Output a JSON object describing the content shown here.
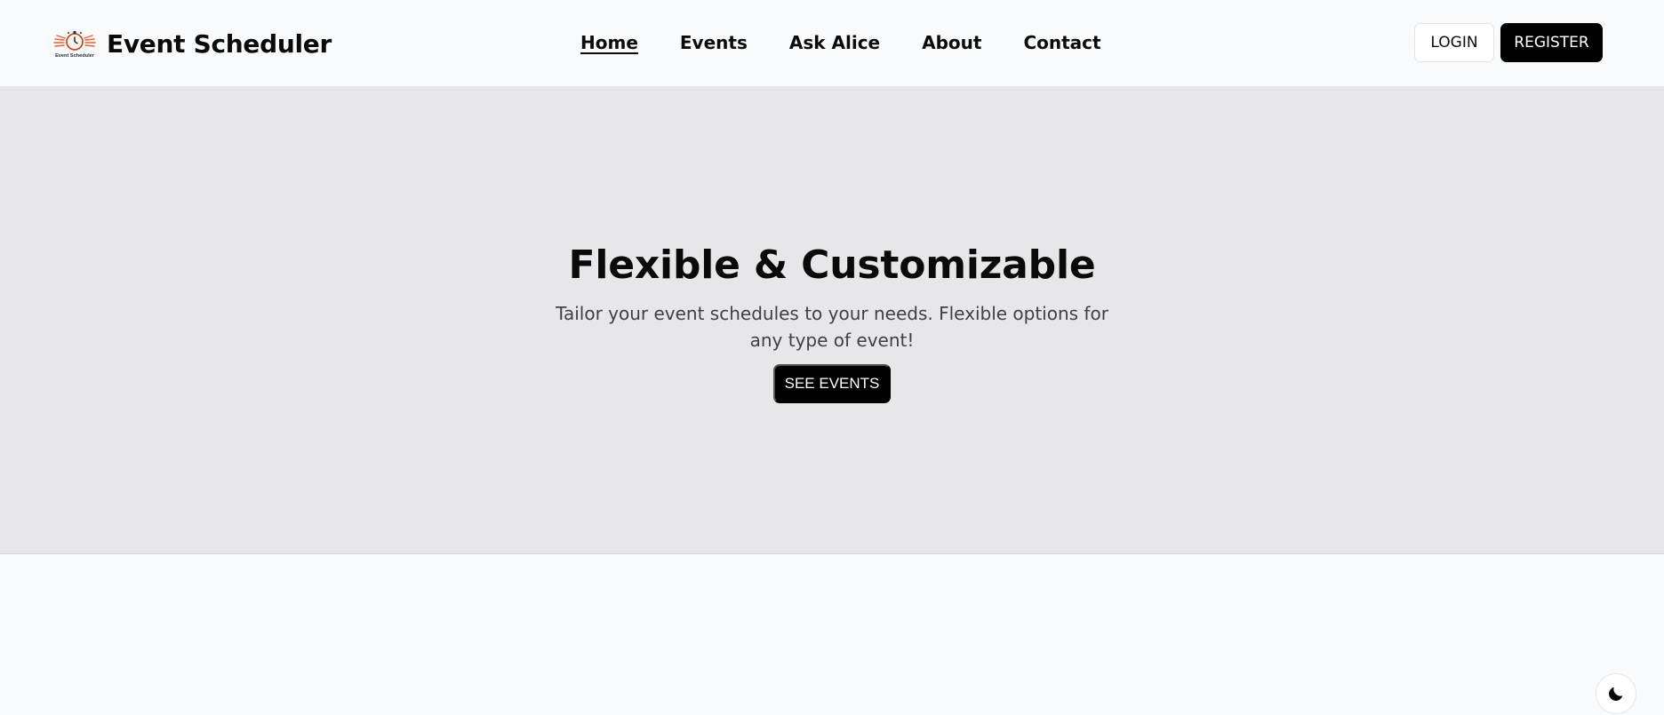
{
  "brand": {
    "title": "Event Scheduler",
    "logo_text": "Event Scheduler",
    "logo_icon": "stopwatch-icon"
  },
  "nav": {
    "items": [
      {
        "label": "Home",
        "active": true
      },
      {
        "label": "Events",
        "active": false
      },
      {
        "label": "Ask Alice",
        "active": false
      },
      {
        "label": "About",
        "active": false
      },
      {
        "label": "Contact",
        "active": false
      }
    ]
  },
  "auth": {
    "login_label": "LOGIN",
    "register_label": "REGISTER"
  },
  "hero": {
    "title": "Flexible & Customizable",
    "subtitle": "Tailor your event schedules to your needs. Flexible options for any type of event!",
    "cta_label": "SEE EVENTS"
  },
  "theme_toggle": {
    "icon": "moon-icon"
  },
  "colors": {
    "header_bg": "#f9fafb",
    "hero_bg": "#e7e7e9",
    "primary": "#000000",
    "logo_accent": "#e8603c"
  }
}
